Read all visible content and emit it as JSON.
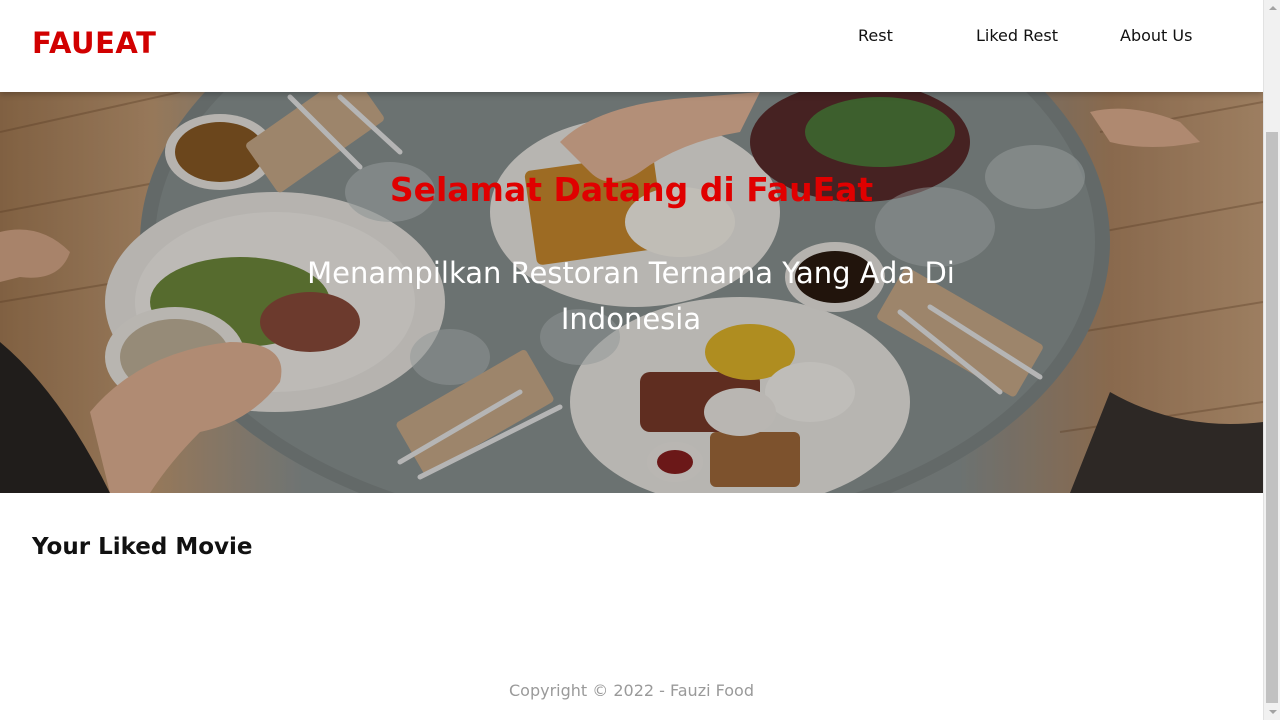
{
  "header": {
    "brand": "FAUEAT",
    "nav": [
      {
        "label": "Rest"
      },
      {
        "label": "Liked Rest"
      },
      {
        "label": "About Us"
      }
    ]
  },
  "hero": {
    "title": "Selamat Datang di FauEat",
    "subtitle": "Menampilkan Restoran Ternama Yang Ada Di Indonesia",
    "image": "breakfast-table-photo"
  },
  "main": {
    "section_title": "Your Liked Movie"
  },
  "footer": {
    "copyright": "Copyright © 2022 - Fauzi Food"
  },
  "colors": {
    "brand": "#d10000",
    "hero_title": "#e00000",
    "footer_text": "#9a9a9a"
  }
}
